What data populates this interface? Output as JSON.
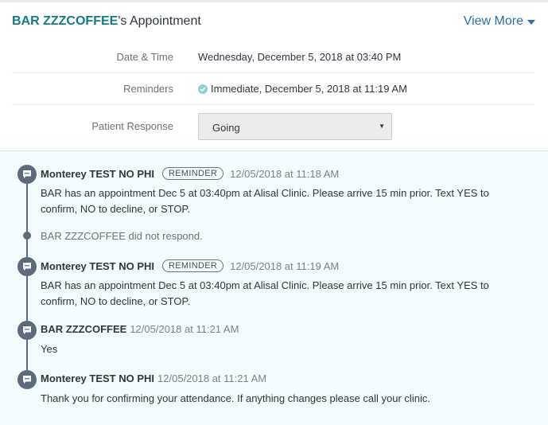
{
  "header": {
    "patient_name": "BAR ZZZCOFFEE",
    "title_suffix": "'s Appointment",
    "view_more": "View More"
  },
  "details": {
    "date_time_label": "Date & Time",
    "date_time_value": "Wednesday, December 5, 2018 at 03:40 PM",
    "reminders_label": "Reminders",
    "reminders_value": "Immediate, December 5, 2018 at 11:19 AM",
    "patient_response_label": "Patient Response",
    "patient_response_value": "Going"
  },
  "timeline": [
    {
      "sender": "Monterey TEST NO PHI",
      "badge": "REMINDER",
      "timestamp": "12/05/2018 at 11:18 AM",
      "message_line1": "BAR has an appointment Dec 5 at 03:40pm at Alisal Clinic. Please arrive 15 min prior. Text YES to",
      "message_line2": "confirm, NO to decline, or STOP."
    },
    {
      "note": "BAR ZZZCOFFEE did not respond."
    },
    {
      "sender": "Monterey TEST NO PHI",
      "badge": "REMINDER",
      "timestamp": "12/05/2018 at 11:19 AM",
      "message_line1": "BAR has an appointment Dec 5 at 03:40pm at Alisal Clinic. Please arrive 15 min prior. Text YES to",
      "message_line2": "confirm, NO to decline, or STOP."
    },
    {
      "sender": "BAR ZZZCOFFEE",
      "timestamp": "12/05/2018 at 11:21 AM",
      "message_line1": "Yes"
    },
    {
      "sender": "Monterey TEST NO PHI",
      "timestamp": "12/05/2018 at 11:21 AM",
      "message_line1": "Thank you for confirming your attendance. If anything changes please call your clinic."
    }
  ],
  "colors": {
    "accent_teal": "#127a82",
    "link_blue": "#2b6fa8",
    "timeline_bg": "#f3fbfd",
    "bubble": "#5d6a7c",
    "check": "#8fcfdc"
  },
  "icons": {
    "view_more": "caret-down-icon",
    "reminder_status": "check-circle-icon",
    "message": "chat-bubble-icon",
    "select": "dropdown-arrow-icon"
  }
}
